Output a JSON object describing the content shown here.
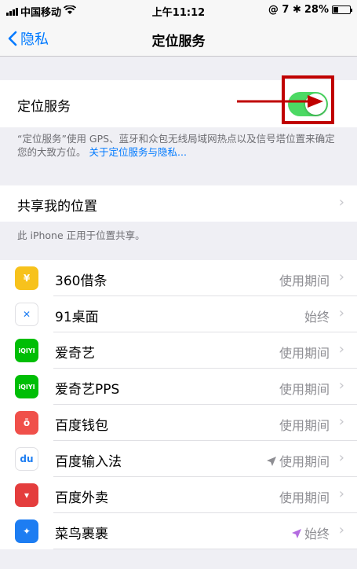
{
  "status_bar": {
    "carrier": "中国移动",
    "time": "上午11:12",
    "indicators": "@ 7 ✱",
    "battery": "28%",
    "battery_level": 0.28
  },
  "nav": {
    "back_label": "隐私",
    "title": "定位服务"
  },
  "location_services": {
    "label": "定位服务",
    "toggle_on": true,
    "description": "“定位服务”使用 GPS、蓝牙和众包无线局域网热点以及信号塔位置来确定您的大致方位。",
    "link": "关于定位服务与隐私..."
  },
  "share_location": {
    "label": "共享我的位置",
    "chevron": "›",
    "note": "此 iPhone 正用于位置共享。"
  },
  "apps": [
    {
      "name": "360借条",
      "status": "使用期间",
      "icon": "360-jietiao-icon",
      "icon_color": "#f7c21c",
      "glyph": "¥",
      "loc_arrow": false
    },
    {
      "name": "91桌面",
      "status": "始终",
      "icon": "91-zhuomian-icon",
      "icon_color": "#ffffff",
      "glyph": "✕",
      "loc_arrow": false
    },
    {
      "name": "爱奇艺",
      "status": "使用期间",
      "icon": "iqiyi-icon",
      "icon_color": "#00be06",
      "glyph": "iQIYI",
      "loc_arrow": false
    },
    {
      "name": "爱奇艺PPS",
      "status": "使用期间",
      "icon": "iqiyi-pps-icon",
      "icon_color": "#00be06",
      "glyph": "iQIYI",
      "loc_arrow": false
    },
    {
      "name": "百度钱包",
      "status": "使用期间",
      "icon": "baidu-wallet-icon",
      "icon_color": "#f0504a",
      "glyph": "ō",
      "loc_arrow": false
    },
    {
      "name": "百度输入法",
      "status": "使用期间",
      "icon": "baidu-input-icon",
      "icon_color": "#ffffff",
      "glyph": "du",
      "loc_arrow": true,
      "loc_arrow_color": "#8e8e93"
    },
    {
      "name": "百度外卖",
      "status": "使用期间",
      "icon": "baidu-waimai-icon",
      "icon_color": "#e43d3d",
      "glyph": "▾",
      "loc_arrow": false
    },
    {
      "name": "菜鸟裹裹",
      "status": "始终",
      "icon": "cainiao-icon",
      "icon_color": "#1d7df2",
      "glyph": "✦",
      "loc_arrow": true,
      "loc_arrow_color": "#b36be0"
    }
  ],
  "colors": {
    "accent": "#007aff",
    "toggle_on": "#4cd964",
    "highlight": "#c00000"
  }
}
